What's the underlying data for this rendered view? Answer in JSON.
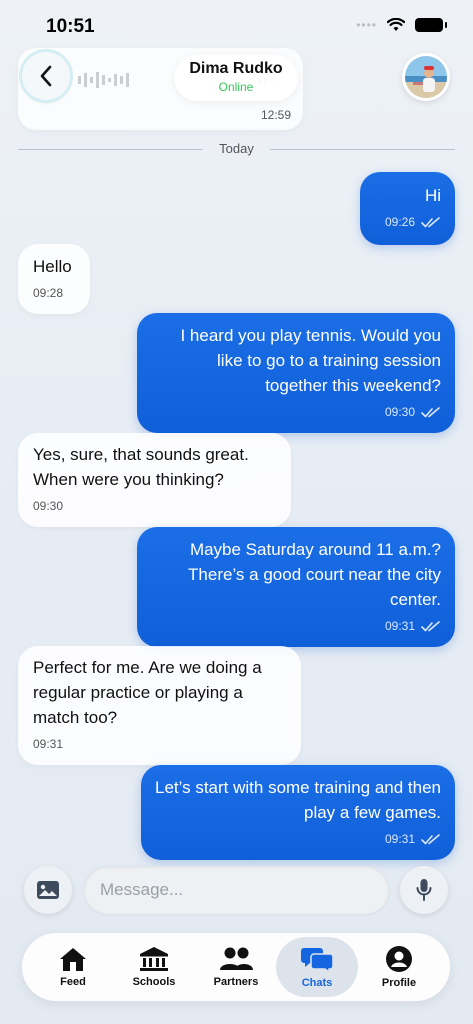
{
  "status_bar": {
    "time": "10:51"
  },
  "header": {
    "prev_time": "12:59",
    "contact_name": "Dima Rudko",
    "contact_status": "Online"
  },
  "day_label": "Today",
  "messages": [
    {
      "dir": "out",
      "text": "Hi",
      "time": "09:26"
    },
    {
      "dir": "in",
      "text": "Hello",
      "time": "09:28"
    },
    {
      "dir": "out",
      "text": "I heard you play tennis. Would you like to go to a training session together this weekend?",
      "time": "09:30"
    },
    {
      "dir": "in",
      "text": "Yes, sure, that sounds great. When were you thinking?",
      "time": "09:30"
    },
    {
      "dir": "out",
      "text": "Maybe Saturday around 11 a.m.? There’s a good court near the city center.",
      "time": "09:31"
    },
    {
      "dir": "in",
      "text": "Perfect for me. Are we doing a regular practice or playing a match too?",
      "time": "09:31"
    },
    {
      "dir": "out",
      "text": "Let’s start with some training and then play a few games.",
      "time": "09:31"
    }
  ],
  "composer": {
    "placeholder": "Message..."
  },
  "tabs": [
    {
      "label": "Feed",
      "icon": "home-icon"
    },
    {
      "label": "Schools",
      "icon": "bank-icon"
    },
    {
      "label": "Partners",
      "icon": "people-icon"
    },
    {
      "label": "Chats",
      "icon": "chat-bubbles-icon",
      "active": true
    },
    {
      "label": "Profile",
      "icon": "user-circle-icon"
    }
  ],
  "colors": {
    "accent": "#1565e0",
    "online": "#34c759",
    "bubble_out": "#1b6ee6"
  }
}
